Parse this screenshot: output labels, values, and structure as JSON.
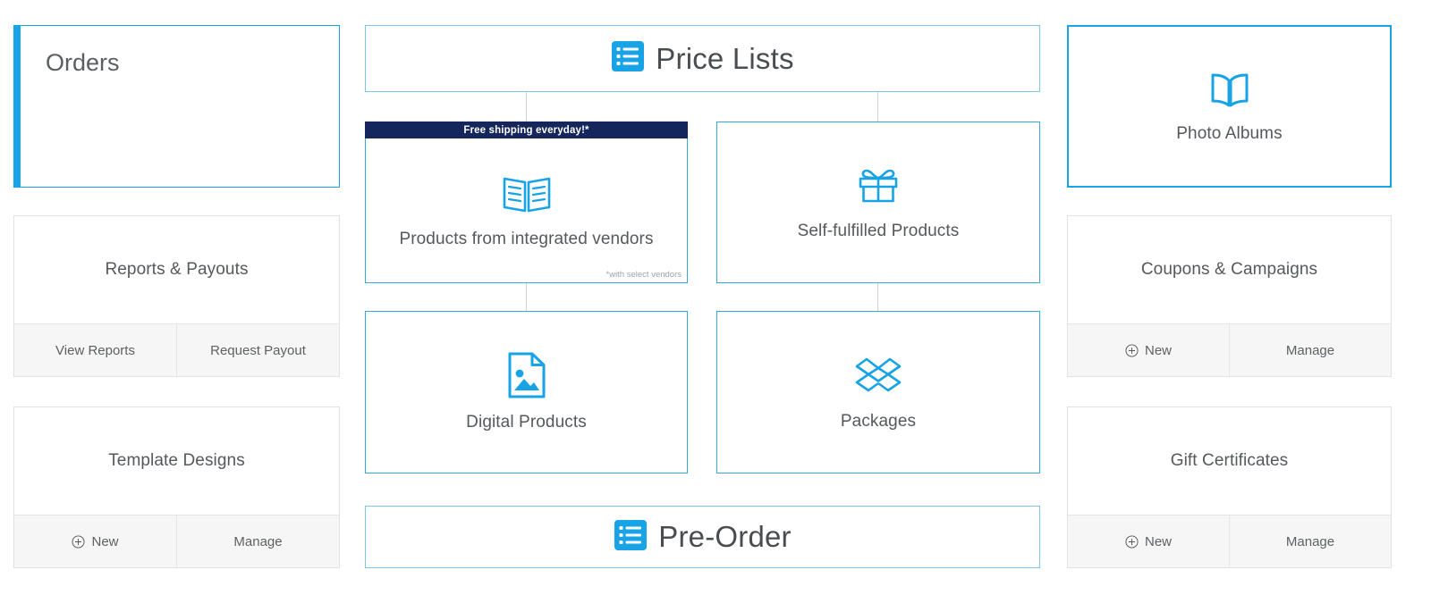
{
  "theme": {
    "accent_blue": "#17a3e6",
    "card_border_blue": "#34a8e0",
    "header_border_blue": "#7cc6ea",
    "promo_navy": "#15265c",
    "text_gray": "#55595c",
    "footer_bg": "#f6f6f6"
  },
  "left_column": {
    "orders": {
      "title": "Orders"
    },
    "reports": {
      "title": "Reports & Payouts",
      "buttons": [
        {
          "label": "View Reports",
          "icon": "none"
        },
        {
          "label": "Request Payout",
          "icon": "none"
        }
      ]
    },
    "templates": {
      "title": "Template Designs",
      "buttons": [
        {
          "label": "New",
          "icon": "plus-circle-icon"
        },
        {
          "label": "Manage",
          "icon": "none"
        }
      ]
    }
  },
  "center_column": {
    "price_lists_header": {
      "title": "Price Lists",
      "icon": "list-icon"
    },
    "cards": [
      {
        "title": "Products from integrated vendors",
        "icon": "open-book-lines-icon",
        "banner": "Free shipping everyday!*",
        "footnote": "*with select vendors"
      },
      {
        "title": "Self-fulfilled Products",
        "icon": "gift-box-icon"
      },
      {
        "title": "Digital Products",
        "icon": "image-document-icon"
      },
      {
        "title": "Packages",
        "icon": "open-package-icon"
      }
    ],
    "pre_order_header": {
      "title": "Pre-Order",
      "icon": "list-icon"
    }
  },
  "right_column": {
    "photo_albums": {
      "title": "Photo Albums",
      "icon": "open-book-icon"
    },
    "coupons": {
      "title": "Coupons & Campaigns",
      "buttons": [
        {
          "label": "New",
          "icon": "plus-circle-icon"
        },
        {
          "label": "Manage",
          "icon": "none"
        }
      ]
    },
    "gift_certificates": {
      "title": "Gift Certificates",
      "buttons": [
        {
          "label": "New",
          "icon": "plus-circle-icon"
        },
        {
          "label": "Manage",
          "icon": "none"
        }
      ]
    }
  }
}
